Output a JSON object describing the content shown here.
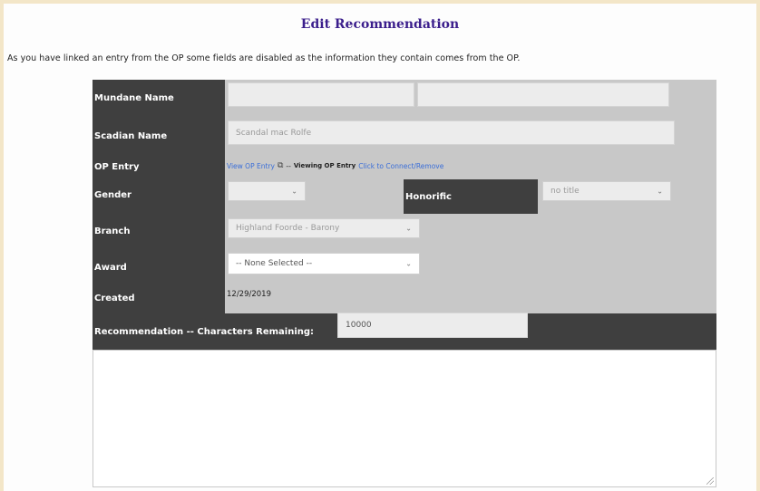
{
  "page": {
    "title": "Edit Recommendation",
    "notice": "As you have linked an entry from the OP some fields are disabled as the information they contain comes from the OP."
  },
  "form": {
    "mundane_name": {
      "label": "Mundane Name",
      "first": "",
      "last": ""
    },
    "scadian_name": {
      "label": "Scadian Name",
      "value": "Scandal mac Rolfe"
    },
    "op_entry": {
      "label": "OP Entry",
      "view_link": "View OP Entry",
      "separator": "--",
      "viewing_label": "Viewing OP Entry",
      "action_link": "Click to Connect/Remove"
    },
    "gender": {
      "label": "Gender",
      "value": ""
    },
    "honorific": {
      "label": "Honorific",
      "value": "no title"
    },
    "branch": {
      "label": "Branch",
      "value": "Highland Foorde - Barony"
    },
    "award": {
      "label": "Award",
      "value": "-- None Selected --"
    },
    "created": {
      "label": "Created",
      "value": "12/29/2019"
    },
    "recommendation": {
      "label": "Recommendation -- Characters Remaining:",
      "chars_remaining": "10000",
      "text": ""
    }
  },
  "icons": {
    "external_link": "external-link-icon",
    "chevron": "chevron-down-icon",
    "resize": "resize-handle-icon"
  },
  "colors": {
    "page_background": "#f3e6c8",
    "title": "#3b1e8c",
    "label_background": "#3f3f3f",
    "form_background": "#c8c8c8",
    "link": "#3a6ed8"
  }
}
